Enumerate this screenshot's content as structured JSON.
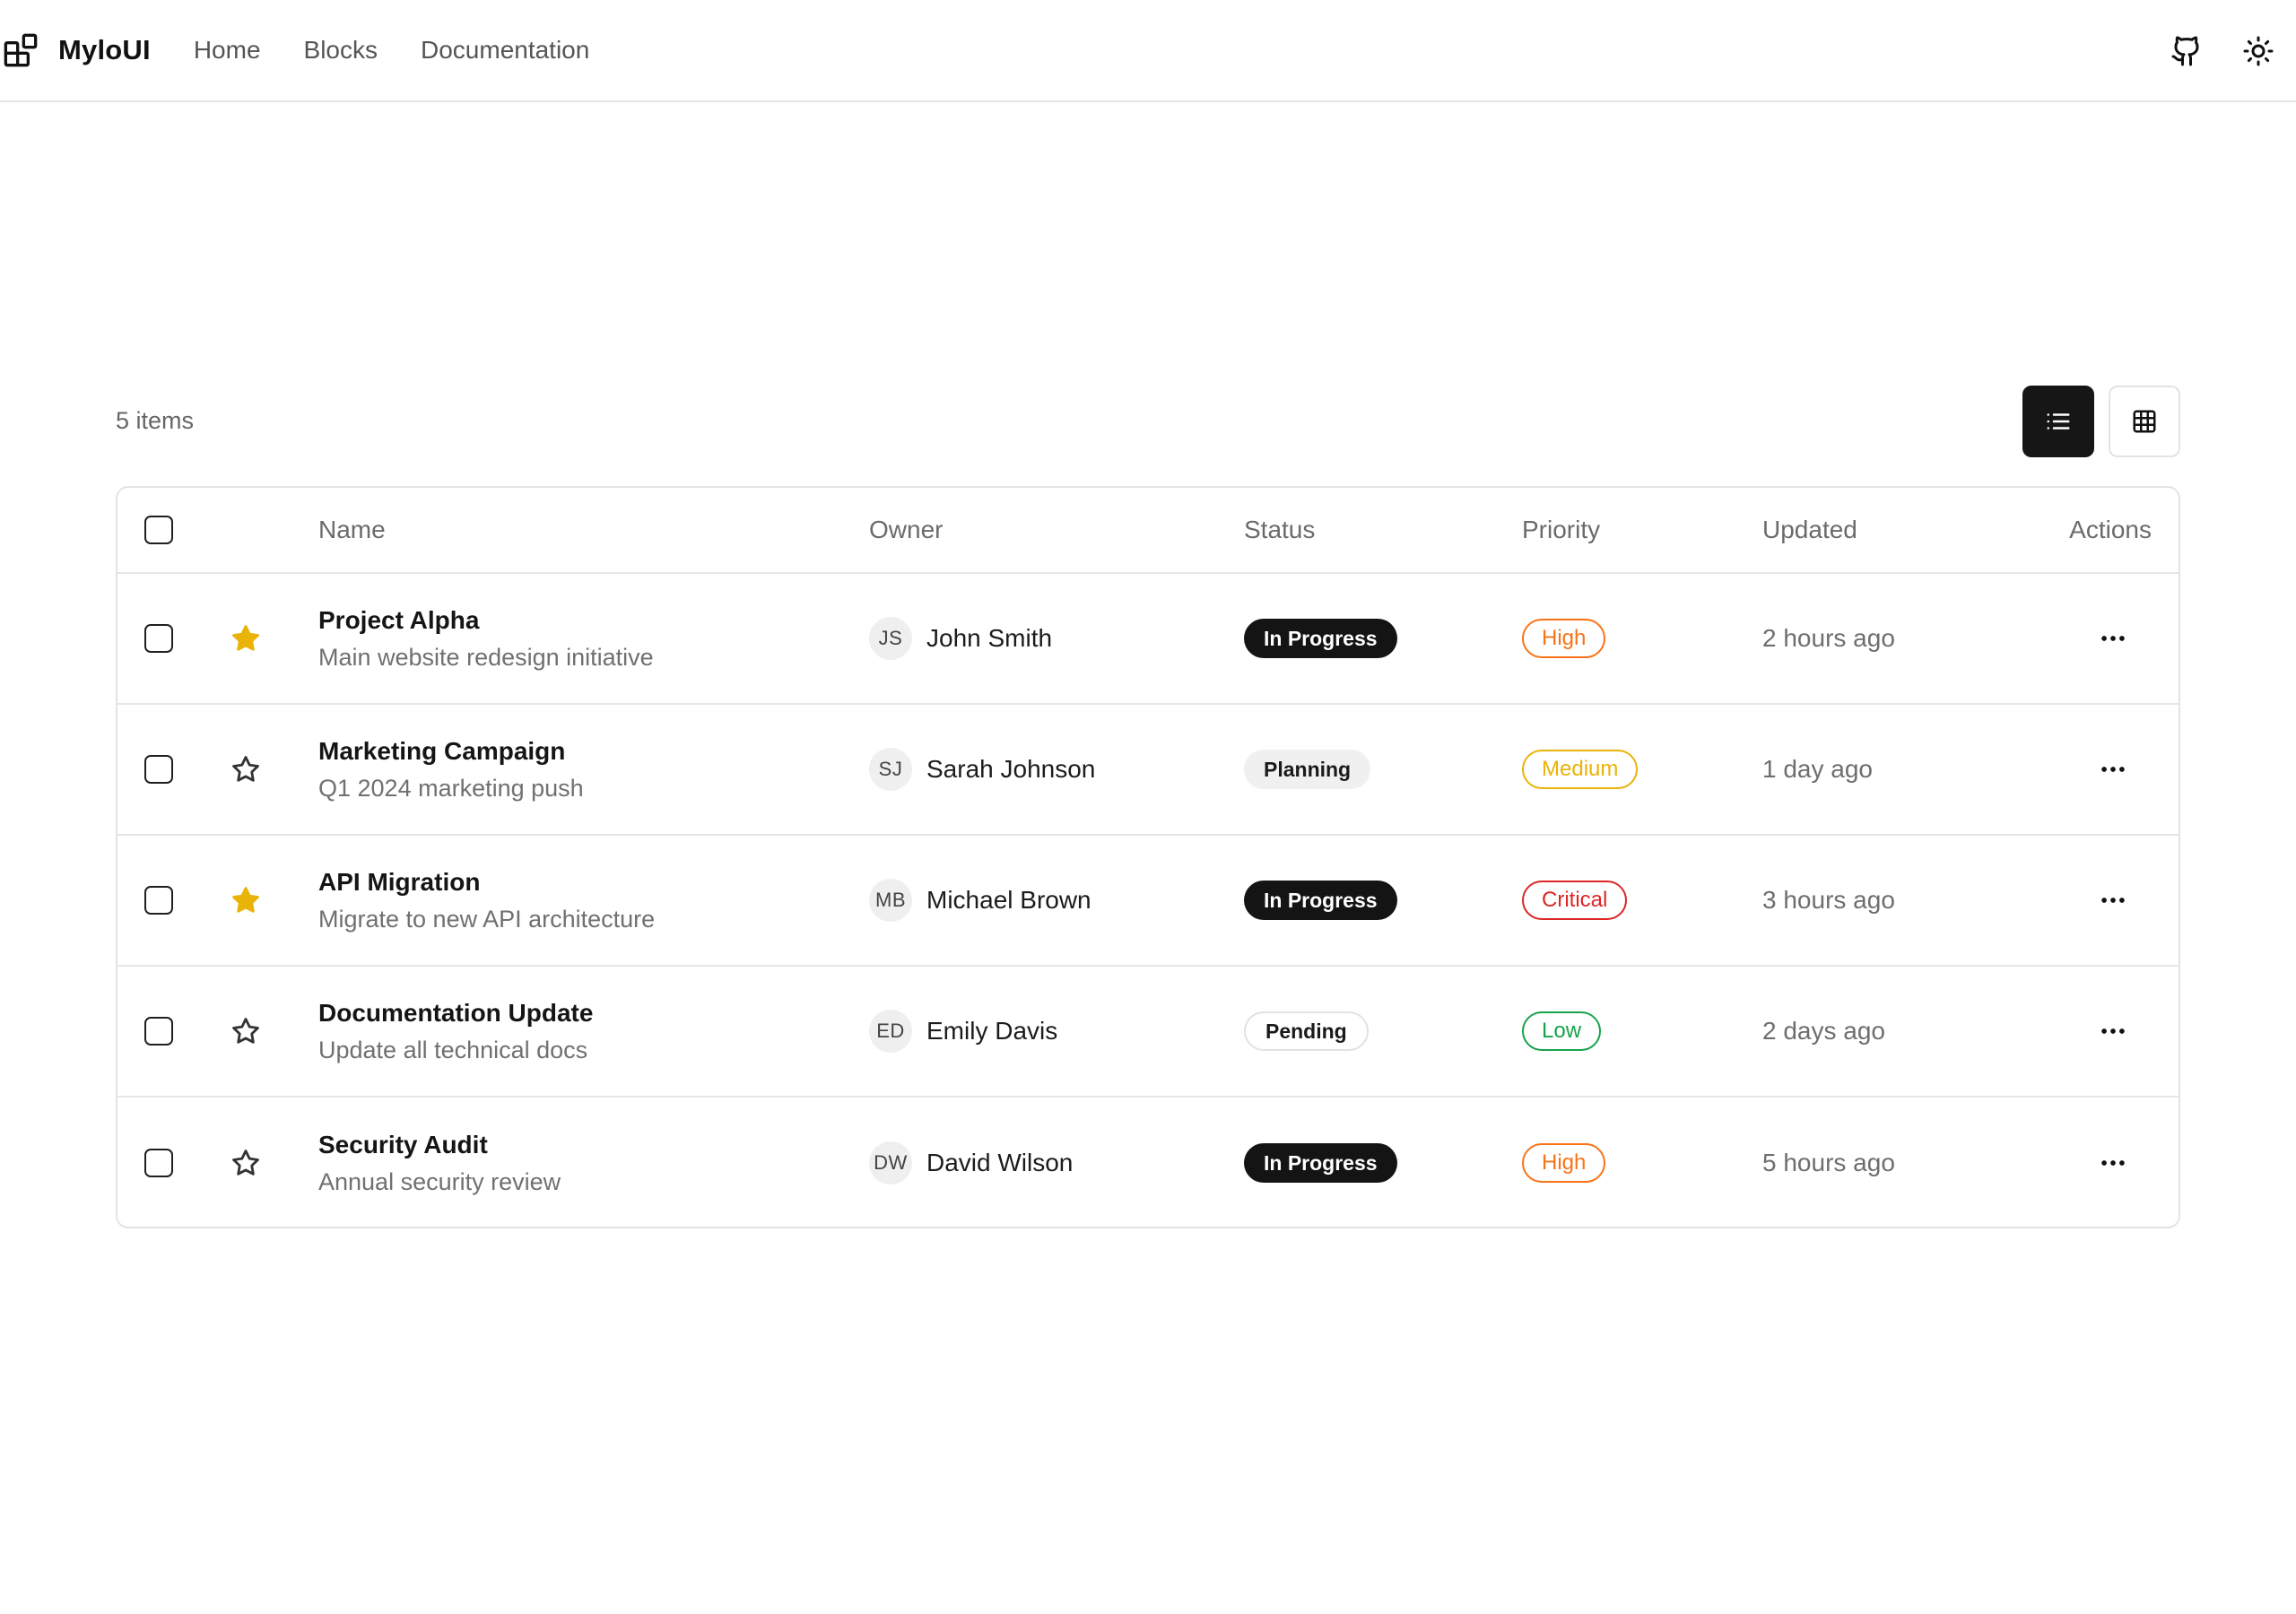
{
  "brand": {
    "name": "MyloUI",
    "icon": "blocks-logo-icon"
  },
  "nav": {
    "items": [
      {
        "label": "Home"
      },
      {
        "label": "Blocks"
      },
      {
        "label": "Documentation"
      }
    ]
  },
  "header_actions": {
    "icons": [
      "github-icon",
      "sun-icon"
    ]
  },
  "toolbar": {
    "count_label": "5 items",
    "view_modes": [
      "list-view",
      "grid-view"
    ],
    "active_view": "list-view"
  },
  "table": {
    "columns": {
      "name": "Name",
      "owner": "Owner",
      "status": "Status",
      "priority": "Priority",
      "updated": "Updated",
      "actions": "Actions"
    },
    "rows": [
      {
        "title": "Project Alpha",
        "subtitle": "Main website redesign initiative",
        "starred": true,
        "owner_initials": "JS",
        "owner": "John Smith",
        "status": "In Progress",
        "priority": "High",
        "updated": "2 hours ago"
      },
      {
        "title": "Marketing Campaign",
        "subtitle": "Q1 2024 marketing push",
        "starred": false,
        "owner_initials": "SJ",
        "owner": "Sarah Johnson",
        "status": "Planning",
        "priority": "Medium",
        "updated": "1 day ago"
      },
      {
        "title": "API Migration",
        "subtitle": "Migrate to new API architecture",
        "starred": true,
        "owner_initials": "MB",
        "owner": "Michael Brown",
        "status": "In Progress",
        "priority": "Critical",
        "updated": "3 hours ago"
      },
      {
        "title": "Documentation Update",
        "subtitle": "Update all technical docs",
        "starred": false,
        "owner_initials": "ED",
        "owner": "Emily Davis",
        "status": "Pending",
        "priority": "Low",
        "updated": "2 days ago"
      },
      {
        "title": "Security Audit",
        "subtitle": "Annual security review",
        "starred": false,
        "owner_initials": "DW",
        "owner": "David Wilson",
        "status": "In Progress",
        "priority": "High",
        "updated": "5 hours ago"
      }
    ]
  },
  "colors": {
    "star_filled": "#eab308",
    "priority_high": "#f97316",
    "priority_medium": "#eab308",
    "priority_critical": "#dc2626",
    "priority_low": "#16a34a"
  }
}
